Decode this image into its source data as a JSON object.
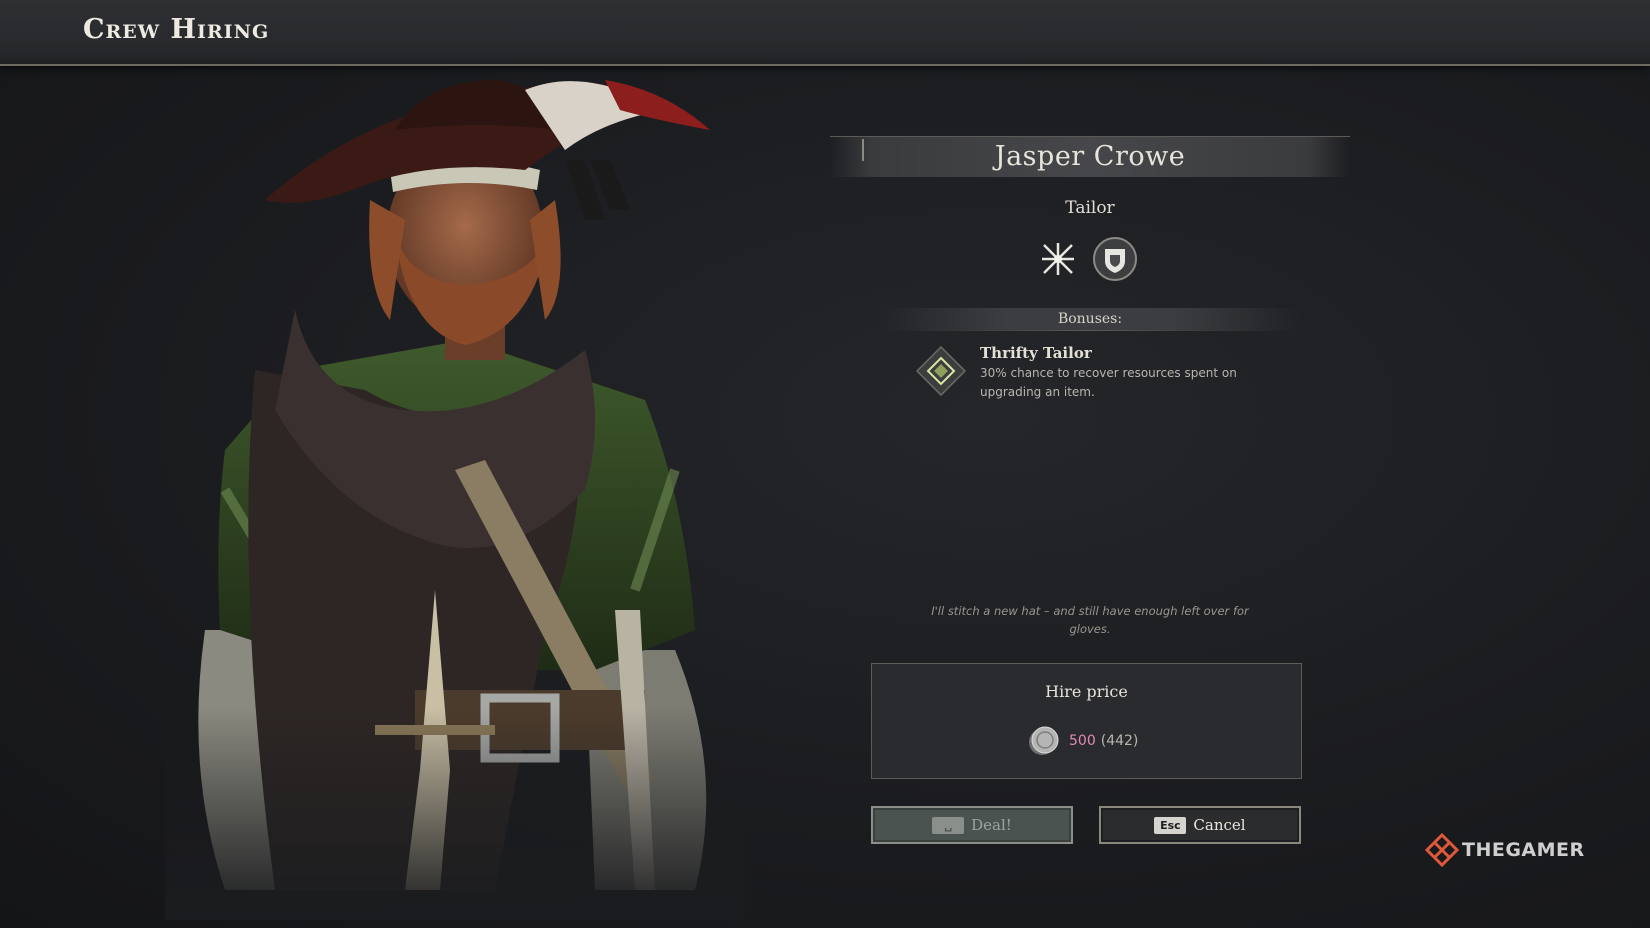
{
  "header": {
    "title": "Crew Hiring"
  },
  "character": {
    "name": "Jasper Crowe",
    "class": "Tailor",
    "trait_icons": [
      "crossed-swords-sparkle-icon",
      "shield-crest-icon"
    ],
    "quote": "I'll stitch a new hat – and still have enough left over for gloves."
  },
  "bonuses": {
    "header": "Bonuses:",
    "items": [
      {
        "icon": "diamond-sigil-icon",
        "title": "Thrifty Tailor",
        "description": "30% chance to recover resources spent on upgrading an item."
      }
    ]
  },
  "hire": {
    "label": "Hire price",
    "currency_icon": "coin-icon",
    "price": "500",
    "owned": "(442)",
    "price_color": "#e389b8"
  },
  "buttons": {
    "deal": {
      "key": "␣",
      "label": "Deal!"
    },
    "cancel": {
      "key": "Esc",
      "label": "Cancel"
    }
  },
  "watermark": {
    "text": "THEGAMER",
    "color": "#e0573a"
  }
}
